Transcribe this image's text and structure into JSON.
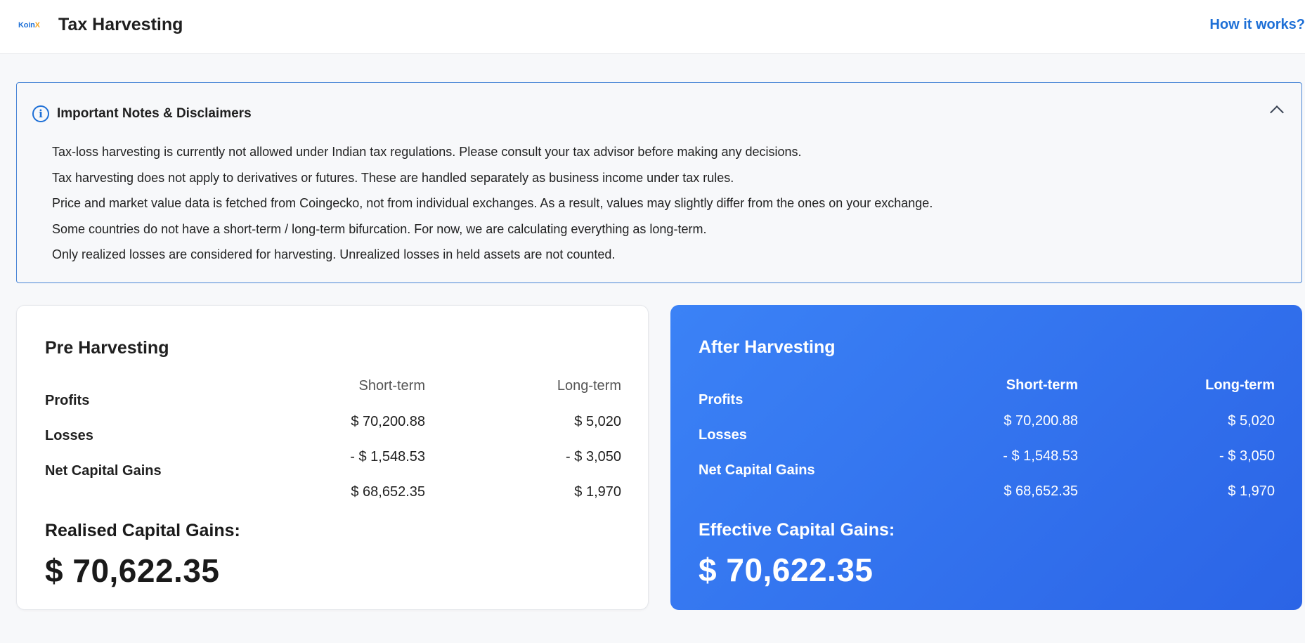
{
  "header": {
    "logo_text_main": "Koin",
    "logo_text_accent": "X",
    "title": "Tax Harvesting",
    "help_link": "How it works?"
  },
  "notes": {
    "title": "Important Notes & Disclaimers",
    "items": [
      "Tax-loss harvesting is currently not allowed under Indian tax regulations. Please consult your tax advisor before making any decisions.",
      "Tax harvesting does not apply to derivatives or futures. These are handled separately as business income under tax rules.",
      "Price and market value data is fetched from Coingecko, not from individual exchanges. As a result, values may slightly differ from the ones on your exchange.",
      "Some countries do not have a short-term / long-term bifurcation. For now, we are calculating everything as long-term.",
      "Only realized losses are considered for harvesting. Unrealized losses in held assets are not counted."
    ]
  },
  "pre": {
    "title": "Pre Harvesting",
    "col_short": "Short-term",
    "col_long": "Long-term",
    "rows": [
      {
        "label": "Profits",
        "short": "$ 70,200.88",
        "long": "$ 5,020"
      },
      {
        "label": "Losses",
        "short": "- $ 1,548.53",
        "long": "- $ 3,050"
      },
      {
        "label": "Net Capital Gains",
        "short": "$ 68,652.35",
        "long": "$ 1,970"
      }
    ],
    "total_label": "Realised Capital Gains:",
    "total_value": "$ 70,622.35"
  },
  "post": {
    "title": "After Harvesting",
    "col_short": "Short-term",
    "col_long": "Long-term",
    "rows": [
      {
        "label": "Profits",
        "short": "$ 70,200.88",
        "long": "$ 5,020"
      },
      {
        "label": "Losses",
        "short": "- $ 1,548.53",
        "long": "- $ 3,050"
      },
      {
        "label": "Net Capital Gains",
        "short": "$ 68,652.35",
        "long": "$ 1,970"
      }
    ],
    "total_label": "Effective Capital Gains:",
    "total_value": "$ 70,622.35"
  },
  "colors": {
    "accent": "#1d6fd6",
    "logo_accent": "#f5a623",
    "after_card_gradient_start": "#3b82f6",
    "after_card_gradient_end": "#2b64e6"
  },
  "icons": {
    "notes": "info-icon",
    "collapse": "chevron-up-icon"
  }
}
